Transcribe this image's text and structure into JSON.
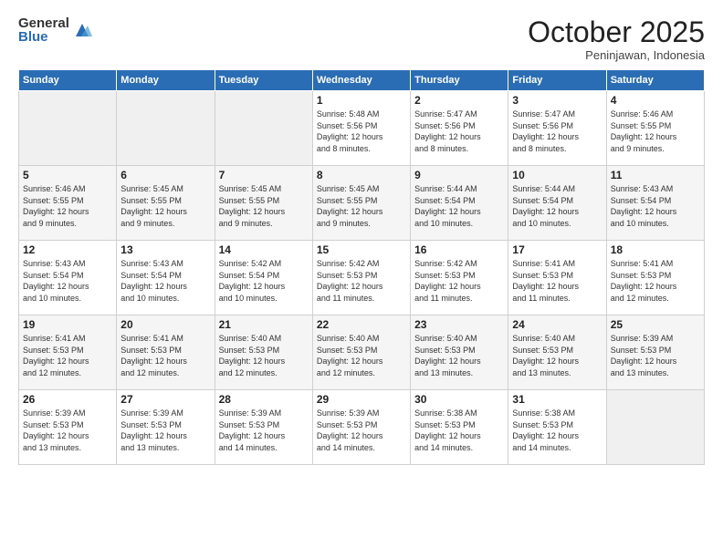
{
  "logo": {
    "general": "General",
    "blue": "Blue"
  },
  "header": {
    "month": "October 2025",
    "location": "Peninjawan, Indonesia"
  },
  "weekdays": [
    "Sunday",
    "Monday",
    "Tuesday",
    "Wednesday",
    "Thursday",
    "Friday",
    "Saturday"
  ],
  "weeks": [
    [
      {
        "day": "",
        "info": ""
      },
      {
        "day": "",
        "info": ""
      },
      {
        "day": "",
        "info": ""
      },
      {
        "day": "1",
        "info": "Sunrise: 5:48 AM\nSunset: 5:56 PM\nDaylight: 12 hours\nand 8 minutes."
      },
      {
        "day": "2",
        "info": "Sunrise: 5:47 AM\nSunset: 5:56 PM\nDaylight: 12 hours\nand 8 minutes."
      },
      {
        "day": "3",
        "info": "Sunrise: 5:47 AM\nSunset: 5:56 PM\nDaylight: 12 hours\nand 8 minutes."
      },
      {
        "day": "4",
        "info": "Sunrise: 5:46 AM\nSunset: 5:55 PM\nDaylight: 12 hours\nand 9 minutes."
      }
    ],
    [
      {
        "day": "5",
        "info": "Sunrise: 5:46 AM\nSunset: 5:55 PM\nDaylight: 12 hours\nand 9 minutes."
      },
      {
        "day": "6",
        "info": "Sunrise: 5:45 AM\nSunset: 5:55 PM\nDaylight: 12 hours\nand 9 minutes."
      },
      {
        "day": "7",
        "info": "Sunrise: 5:45 AM\nSunset: 5:55 PM\nDaylight: 12 hours\nand 9 minutes."
      },
      {
        "day": "8",
        "info": "Sunrise: 5:45 AM\nSunset: 5:55 PM\nDaylight: 12 hours\nand 9 minutes."
      },
      {
        "day": "9",
        "info": "Sunrise: 5:44 AM\nSunset: 5:54 PM\nDaylight: 12 hours\nand 10 minutes."
      },
      {
        "day": "10",
        "info": "Sunrise: 5:44 AM\nSunset: 5:54 PM\nDaylight: 12 hours\nand 10 minutes."
      },
      {
        "day": "11",
        "info": "Sunrise: 5:43 AM\nSunset: 5:54 PM\nDaylight: 12 hours\nand 10 minutes."
      }
    ],
    [
      {
        "day": "12",
        "info": "Sunrise: 5:43 AM\nSunset: 5:54 PM\nDaylight: 12 hours\nand 10 minutes."
      },
      {
        "day": "13",
        "info": "Sunrise: 5:43 AM\nSunset: 5:54 PM\nDaylight: 12 hours\nand 10 minutes."
      },
      {
        "day": "14",
        "info": "Sunrise: 5:42 AM\nSunset: 5:54 PM\nDaylight: 12 hours\nand 10 minutes."
      },
      {
        "day": "15",
        "info": "Sunrise: 5:42 AM\nSunset: 5:53 PM\nDaylight: 12 hours\nand 11 minutes."
      },
      {
        "day": "16",
        "info": "Sunrise: 5:42 AM\nSunset: 5:53 PM\nDaylight: 12 hours\nand 11 minutes."
      },
      {
        "day": "17",
        "info": "Sunrise: 5:41 AM\nSunset: 5:53 PM\nDaylight: 12 hours\nand 11 minutes."
      },
      {
        "day": "18",
        "info": "Sunrise: 5:41 AM\nSunset: 5:53 PM\nDaylight: 12 hours\nand 12 minutes."
      }
    ],
    [
      {
        "day": "19",
        "info": "Sunrise: 5:41 AM\nSunset: 5:53 PM\nDaylight: 12 hours\nand 12 minutes."
      },
      {
        "day": "20",
        "info": "Sunrise: 5:41 AM\nSunset: 5:53 PM\nDaylight: 12 hours\nand 12 minutes."
      },
      {
        "day": "21",
        "info": "Sunrise: 5:40 AM\nSunset: 5:53 PM\nDaylight: 12 hours\nand 12 minutes."
      },
      {
        "day": "22",
        "info": "Sunrise: 5:40 AM\nSunset: 5:53 PM\nDaylight: 12 hours\nand 12 minutes."
      },
      {
        "day": "23",
        "info": "Sunrise: 5:40 AM\nSunset: 5:53 PM\nDaylight: 12 hours\nand 13 minutes."
      },
      {
        "day": "24",
        "info": "Sunrise: 5:40 AM\nSunset: 5:53 PM\nDaylight: 12 hours\nand 13 minutes."
      },
      {
        "day": "25",
        "info": "Sunrise: 5:39 AM\nSunset: 5:53 PM\nDaylight: 12 hours\nand 13 minutes."
      }
    ],
    [
      {
        "day": "26",
        "info": "Sunrise: 5:39 AM\nSunset: 5:53 PM\nDaylight: 12 hours\nand 13 minutes."
      },
      {
        "day": "27",
        "info": "Sunrise: 5:39 AM\nSunset: 5:53 PM\nDaylight: 12 hours\nand 13 minutes."
      },
      {
        "day": "28",
        "info": "Sunrise: 5:39 AM\nSunset: 5:53 PM\nDaylight: 12 hours\nand 14 minutes."
      },
      {
        "day": "29",
        "info": "Sunrise: 5:39 AM\nSunset: 5:53 PM\nDaylight: 12 hours\nand 14 minutes."
      },
      {
        "day": "30",
        "info": "Sunrise: 5:38 AM\nSunset: 5:53 PM\nDaylight: 12 hours\nand 14 minutes."
      },
      {
        "day": "31",
        "info": "Sunrise: 5:38 AM\nSunset: 5:53 PM\nDaylight: 12 hours\nand 14 minutes."
      },
      {
        "day": "",
        "info": ""
      }
    ]
  ]
}
